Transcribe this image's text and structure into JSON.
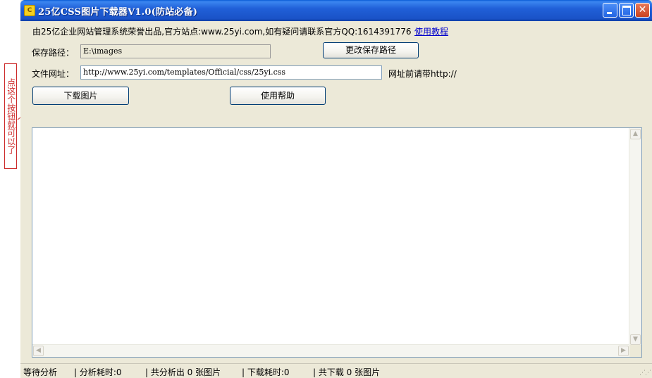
{
  "window": {
    "title": "25亿CSS图片下载器V1.0(防站必备)",
    "icon_glyph": "C"
  },
  "annotation": {
    "text": "点这个按钮就可以了"
  },
  "info": {
    "text": "由25亿企业网站管理系统荣誉出品,官方站点:www.25yi.com,如有疑问请联系官方QQ:1614391776",
    "help_link": "使用教程"
  },
  "save_path": {
    "label": "保存路径：",
    "value": "E:\\images",
    "change_button": "更改保存路径"
  },
  "file_url": {
    "label": "文件网址：",
    "value": "http://www.25yi.com/templates/Official/css/25yi.css",
    "hint": "网址前请带http://"
  },
  "buttons": {
    "download": "下载图片",
    "help": "使用帮助"
  },
  "status": {
    "state": "等待分析",
    "analyze_time": "| 分析耗时:0",
    "total_parsed": "| 共分析出 0 张图片",
    "download_time": "| 下载耗时:0",
    "total_downloaded": "| 共下载 0 张图片"
  },
  "colors": {
    "titlebar": "#1a52c7",
    "face": "#ece9d8",
    "annotation": "#cc2a2a",
    "link": "#0000cc"
  }
}
